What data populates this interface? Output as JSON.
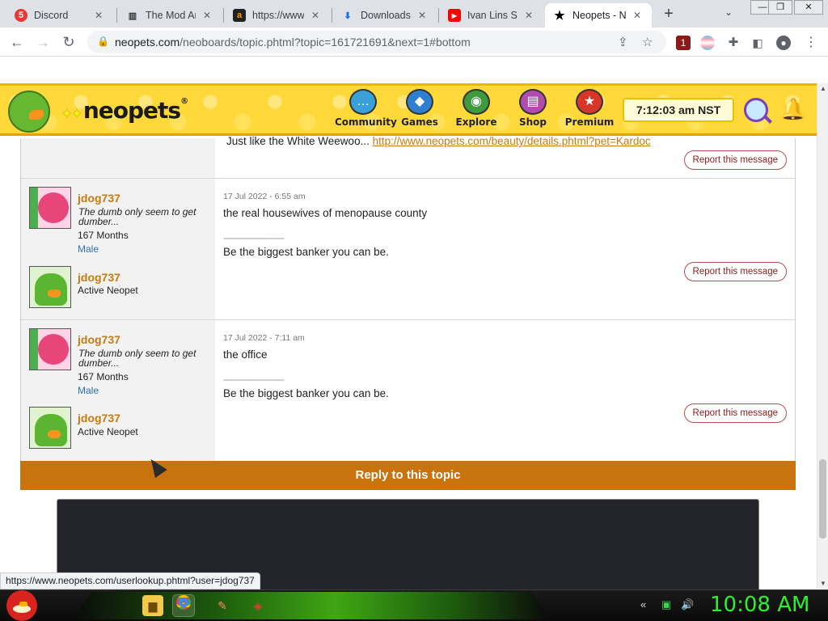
{
  "browser": {
    "tabs": [
      {
        "title": "Discord",
        "icon": "discord-icon",
        "badge": "5"
      },
      {
        "title": "The Mod Ar",
        "icon": "chart-icon"
      },
      {
        "title": "https://www.",
        "icon": "amazon-icon"
      },
      {
        "title": "Downloads",
        "icon": "download-icon"
      },
      {
        "title": "Ivan Lins So",
        "icon": "youtube-icon"
      },
      {
        "title": "Neopets - N",
        "icon": "star-icon",
        "active": true
      }
    ],
    "close_glyph": "✕",
    "new_tab_glyph": "+",
    "tab_menu_glyph": "⌄",
    "url_host": "neopets.com",
    "url_path": "/neoboards/topic.phtml?topic=161721691&next=1#bottom",
    "extension_badge": "1",
    "window_controls": [
      "—",
      "❐",
      "✕"
    ]
  },
  "neopets": {
    "logo": "neopets",
    "logo_mark": "✦✦",
    "nav": [
      {
        "label": "Community",
        "icon": "community-icon",
        "color": "#3aa0d8",
        "glyph": "…"
      },
      {
        "label": "Games",
        "icon": "games-icon",
        "color": "#2f7fd1",
        "glyph": "◆"
      },
      {
        "label": "Explore",
        "icon": "explore-icon",
        "color": "#3d9a3d",
        "glyph": "◉"
      },
      {
        "label": "Shop",
        "icon": "shop-icon",
        "color": "#b04bb0",
        "glyph": "▤"
      },
      {
        "label": "Premium",
        "icon": "premium-icon",
        "color": "#d9362a",
        "glyph": "★"
      }
    ],
    "clock": "7:12:03 am NST"
  },
  "thread": {
    "prev_snippet_text": "Just like the White Weewoo...",
    "prev_snippet_link": "http://www.neopets.com/beauty/details.phtml?pet=Kardoc",
    "report_label": "Report this message",
    "posts": [
      {
        "author": "jdog737",
        "tagline": "The dumb only seem to get dumber...",
        "months": "167 Months",
        "gender": "Male",
        "pet_name": "jdog737",
        "pet_status": "Active Neopet",
        "date": "17 Jul 2022 - 6:55 am",
        "body": "the real housewives of menopause county",
        "sig_rule": "-------------------------",
        "signature": "Be the biggest banker you can be."
      },
      {
        "author": "jdog737",
        "tagline": "The dumb only seem to get dumber...",
        "months": "167 Months",
        "gender": "Male",
        "pet_name": "jdog737",
        "pet_status": "Active Neopet",
        "date": "17 Jul 2022 - 7:11 am",
        "body": "the office",
        "sig_rule": "-------------------------",
        "signature": "Be the biggest banker you can be."
      }
    ],
    "reply_label": "Reply to this topic"
  },
  "status_bar_url": "https://www.neopets.com/userlookup.phtml?user=jdog737",
  "taskbar": {
    "clock": "10:08 AM"
  }
}
